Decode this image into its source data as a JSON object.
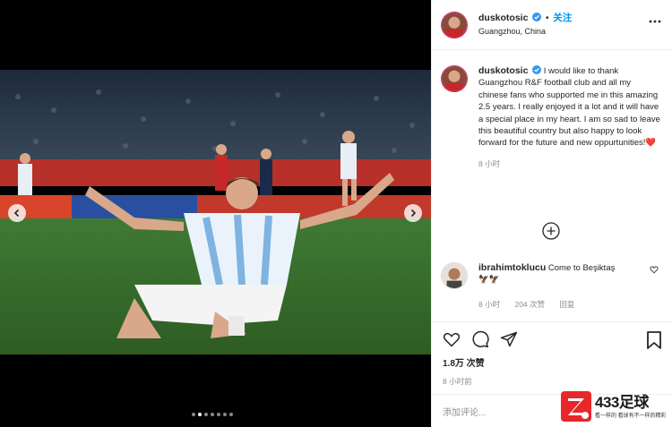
{
  "post": {
    "username": "duskotosic",
    "follow_label": "关注",
    "separator": "•",
    "location": "Guangzhou, China",
    "caption": "I would like to thank Guangzhou R&F football club and all my chinese fans who supported me in this amazing 2.5 years. I really enjoyed it a lot and it will have a special place in my heart. I am so sad to leave this beautiful country but also happy to look forward for the future and new oppurtunities!",
    "caption_emoji": "❤️",
    "caption_time": "8 小时"
  },
  "reply": {
    "username": "ibrahimtoklucu",
    "text": "Come to Beşiktaş",
    "emoji": "🦅🦅",
    "time": "8 小时",
    "likes": "204 次赞",
    "reply_label": "回复"
  },
  "actions": {
    "likes": "1.8万 次赞",
    "time": "8 小时前",
    "comment_placeholder": "添加评论..."
  },
  "carousel": {
    "slide_count": 7,
    "active_slide": 2
  },
  "watermark": {
    "brand": "433足球",
    "tagline": "看一样的 看球有不一样的精彩"
  },
  "colors": {
    "accent": "#0095f6",
    "heart": "#ed4956",
    "story_ring": "#d62976",
    "watermark_red": "#e9262a"
  }
}
